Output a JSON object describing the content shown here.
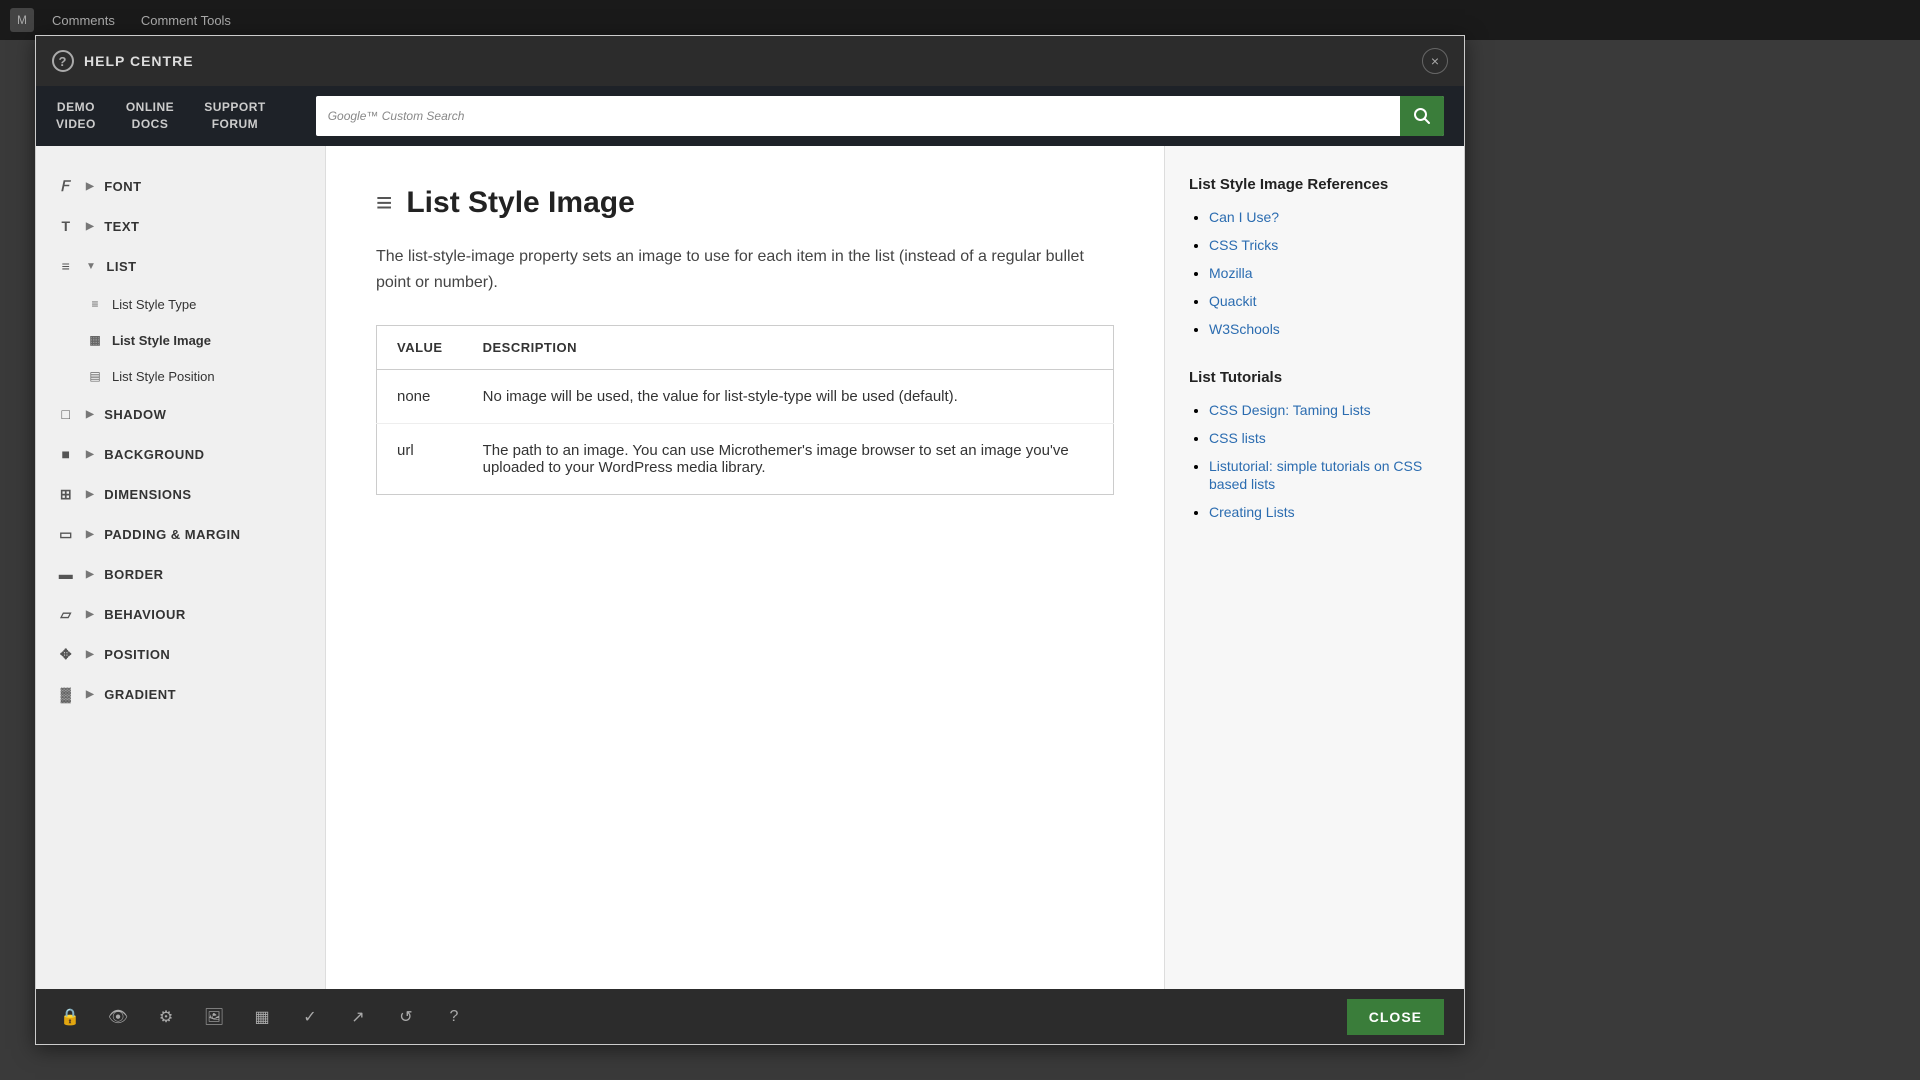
{
  "appBar": {
    "title": "Comments",
    "subtitle": "Comment Tools"
  },
  "modal": {
    "title": "HELP CENTRE",
    "closeLabel": "×"
  },
  "navBar": {
    "buttons": [
      {
        "id": "demo-video",
        "line1": "DEMO",
        "line2": "VIDEO"
      },
      {
        "id": "online-docs",
        "line1": "ONLINE",
        "line2": "DOCS"
      },
      {
        "id": "support-forum",
        "line1": "SUPPORT",
        "line2": "FORUM"
      }
    ],
    "search": {
      "placeholder": "Google™ Custom Search",
      "icon": "🔍"
    }
  },
  "sidebar": {
    "sections": [
      {
        "id": "font",
        "label": "FONT",
        "icon": "𝐹",
        "expanded": false
      },
      {
        "id": "text",
        "label": "TEXT",
        "icon": "T",
        "expanded": false
      },
      {
        "id": "list",
        "label": "LIST",
        "icon": "≡",
        "expanded": true,
        "children": [
          {
            "id": "list-style-type",
            "label": "List Style Type",
            "icon": "≡",
            "active": false
          },
          {
            "id": "list-style-image",
            "label": "List Style Image",
            "icon": "▦",
            "active": true
          },
          {
            "id": "list-style-position",
            "label": "List Style Position",
            "icon": "▤",
            "active": false
          }
        ]
      },
      {
        "id": "shadow",
        "label": "SHADOW",
        "icon": "□",
        "expanded": false
      },
      {
        "id": "background",
        "label": "BACKGROUND",
        "icon": "■",
        "expanded": false
      },
      {
        "id": "dimensions",
        "label": "DIMENSIONS",
        "icon": "⊞",
        "expanded": false
      },
      {
        "id": "padding-margin",
        "label": "PADDING & MARGIN",
        "icon": "▭",
        "expanded": false
      },
      {
        "id": "border",
        "label": "BORDER",
        "icon": "▬",
        "expanded": false
      },
      {
        "id": "behaviour",
        "label": "BEHAVIOUR",
        "icon": "▱",
        "expanded": false
      },
      {
        "id": "position",
        "label": "POSITION",
        "icon": "✥",
        "expanded": false
      },
      {
        "id": "gradient",
        "label": "GRADIENT",
        "icon": "▓",
        "expanded": false
      }
    ]
  },
  "article": {
    "icon": "≡",
    "title": "List Style Image",
    "description": "The list-style-image property sets an image to use for each item in the list (instead of a regular bullet point or number).",
    "tableHeaders": [
      "VALUE",
      "DESCRIPTION"
    ],
    "tableRows": [
      {
        "value": "none",
        "description": "No image will be used, the value for list-style-type will be used (default)."
      },
      {
        "value": "url",
        "description": "The path to an image. You can use Microthemer's image browser to set an image you've uploaded to your WordPress media library."
      }
    ]
  },
  "references": {
    "title": "List Style Image References",
    "links": [
      {
        "label": "Can I Use?",
        "href": "#"
      },
      {
        "label": "CSS Tricks",
        "href": "#"
      },
      {
        "label": "Mozilla",
        "href": "#"
      },
      {
        "label": "Quackit",
        "href": "#"
      },
      {
        "label": "W3Schools",
        "href": "#"
      }
    ],
    "tutorialsTitle": "List Tutorials",
    "tutorialLinks": [
      {
        "label": "CSS Design: Taming Lists",
        "href": "#"
      },
      {
        "label": "CSS lists",
        "href": "#"
      },
      {
        "label": "Listutorial: simple tutorials on CSS based lists",
        "href": "#"
      },
      {
        "label": "Creating Lists",
        "href": "#"
      }
    ]
  },
  "bottomToolbar": {
    "tools": [
      "🔒",
      "👁",
      "⚙",
      "🖼",
      "▦",
      "✓",
      "↗",
      "↺",
      "?"
    ],
    "closeLabel": "CLOSE"
  }
}
